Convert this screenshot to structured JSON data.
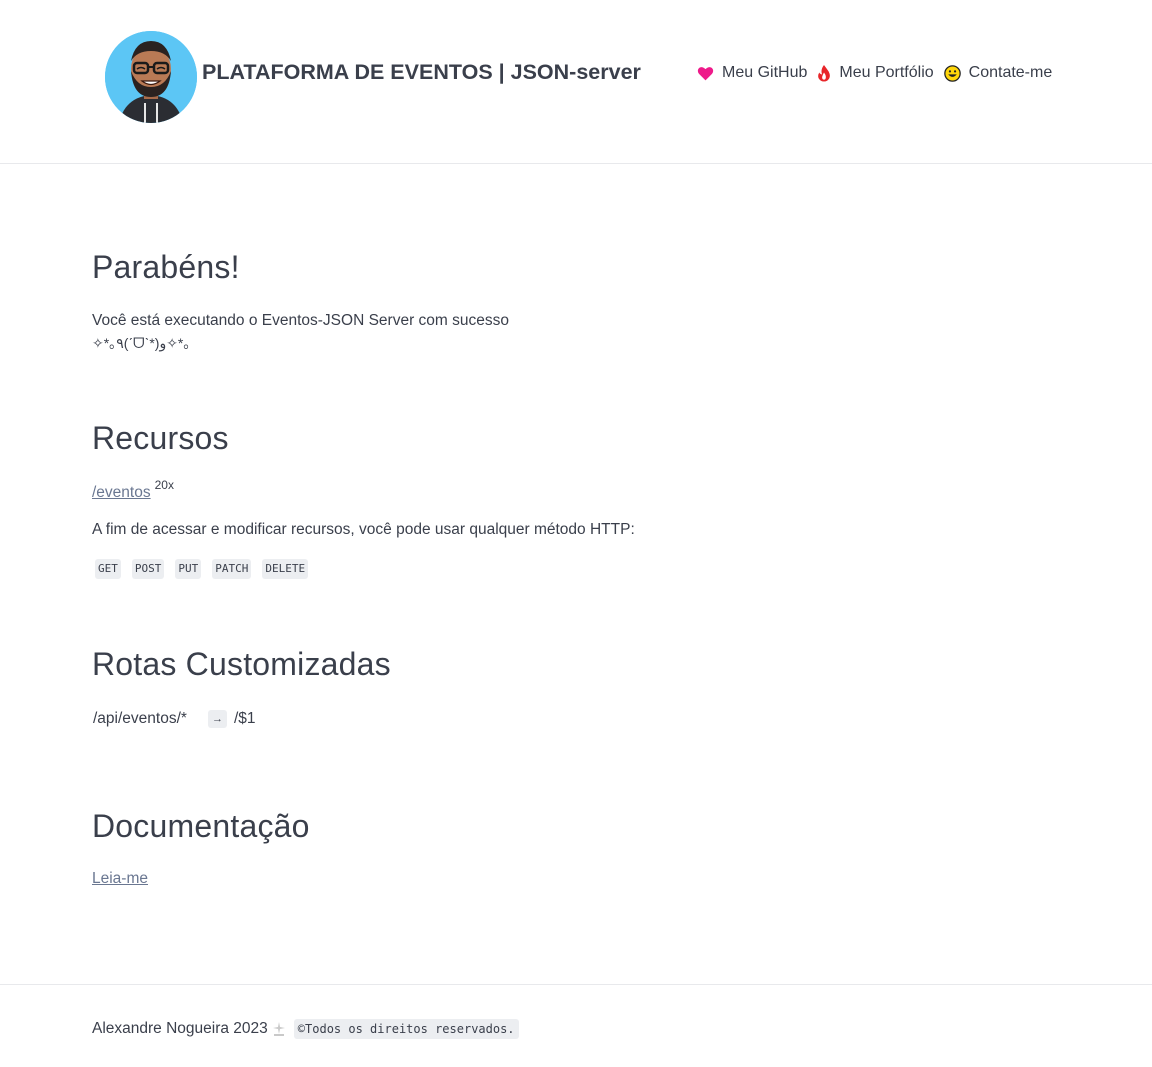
{
  "header": {
    "title": "PLATAFORMA DE EVENTOS | JSON-server",
    "nav": [
      {
        "label": "Meu GitHub",
        "icon": "heart-icon",
        "color": "#ee1a8a"
      },
      {
        "label": "Meu Portfólio",
        "icon": "fire-icon",
        "color": "#e8262a"
      },
      {
        "label": "Contate-me",
        "icon": "smiley-icon",
        "color": "#ffd60a"
      }
    ]
  },
  "sections": {
    "congrats": {
      "heading": "Parabéns!",
      "line1": "Você está executando o Eventos-JSON Server com sucesso",
      "line2": "✧*｡٩(ˊᗜˋ*)و✧*｡"
    },
    "resources": {
      "heading": "Recursos",
      "link": "/eventos",
      "count": "20x",
      "description": "A fim de acessar e modificar recursos, você pode usar qualquer método HTTP:",
      "methods": [
        "GET",
        "POST",
        "PUT",
        "PATCH",
        "DELETE"
      ]
    },
    "routes": {
      "heading": "Rotas Customizadas",
      "from": "/api/eventos/*",
      "arrow": "→",
      "to": "/$1"
    },
    "docs": {
      "heading": "Documentação",
      "link": "Leia-me"
    }
  },
  "footer": {
    "author": "Alexandre Nogueira 2023",
    "icon": "sparkle-icon",
    "rights": "©Todos os direitos reservados."
  }
}
